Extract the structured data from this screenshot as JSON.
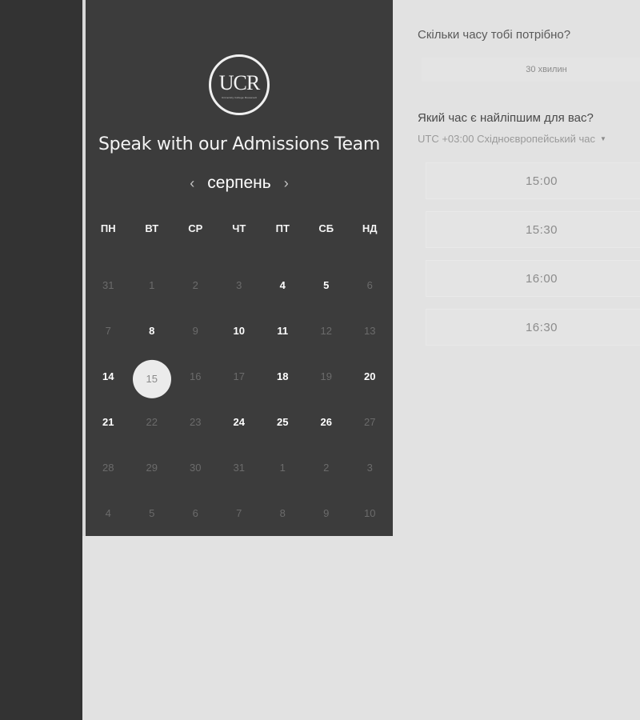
{
  "calendar": {
    "logo": {
      "text": "UCR",
      "subtitle": "University College Roosevelt"
    },
    "title": "Speak with our Admissions Team",
    "month": "серпень",
    "prev_icon": "chevron-left-icon",
    "next_icon": "chevron-right-icon",
    "weekdays": [
      "ПН",
      "ВТ",
      "СР",
      "ЧТ",
      "ПТ",
      "СБ",
      "НД"
    ],
    "days": [
      {
        "label": "31",
        "state": "disabled"
      },
      {
        "label": "1",
        "state": "disabled"
      },
      {
        "label": "2",
        "state": "disabled"
      },
      {
        "label": "3",
        "state": "disabled"
      },
      {
        "label": "4",
        "state": "available"
      },
      {
        "label": "5",
        "state": "available"
      },
      {
        "label": "6",
        "state": "disabled"
      },
      {
        "label": "7",
        "state": "disabled"
      },
      {
        "label": "8",
        "state": "available"
      },
      {
        "label": "9",
        "state": "disabled"
      },
      {
        "label": "10",
        "state": "available"
      },
      {
        "label": "11",
        "state": "available"
      },
      {
        "label": "12",
        "state": "disabled"
      },
      {
        "label": "13",
        "state": "disabled"
      },
      {
        "label": "14",
        "state": "available"
      },
      {
        "label": "15",
        "state": "selected"
      },
      {
        "label": "16",
        "state": "disabled"
      },
      {
        "label": "17",
        "state": "disabled"
      },
      {
        "label": "18",
        "state": "available"
      },
      {
        "label": "19",
        "state": "disabled"
      },
      {
        "label": "20",
        "state": "available"
      },
      {
        "label": "21",
        "state": "available"
      },
      {
        "label": "22",
        "state": "disabled"
      },
      {
        "label": "23",
        "state": "disabled"
      },
      {
        "label": "24",
        "state": "available"
      },
      {
        "label": "25",
        "state": "available"
      },
      {
        "label": "26",
        "state": "available"
      },
      {
        "label": "27",
        "state": "disabled"
      },
      {
        "label": "28",
        "state": "disabled"
      },
      {
        "label": "29",
        "state": "disabled"
      },
      {
        "label": "30",
        "state": "disabled"
      },
      {
        "label": "31",
        "state": "disabled"
      },
      {
        "label": "1",
        "state": "disabled"
      },
      {
        "label": "2",
        "state": "disabled"
      },
      {
        "label": "3",
        "state": "disabled"
      },
      {
        "label": "4",
        "state": "disabled"
      },
      {
        "label": "5",
        "state": "disabled"
      },
      {
        "label": "6",
        "state": "disabled"
      },
      {
        "label": "7",
        "state": "disabled"
      },
      {
        "label": "8",
        "state": "disabled"
      },
      {
        "label": "9",
        "state": "disabled"
      },
      {
        "label": "10",
        "state": "disabled"
      }
    ]
  },
  "scheduler": {
    "duration_question": "Скільки часу тобі потрібно?",
    "duration_value": "30 хвилин",
    "time_question": "Який час є найліпшим для вас?",
    "timezone": "UTC +03:00 Східноєвропейський час",
    "timezone_icon": "caret-down-icon",
    "slots": [
      "15:00",
      "15:30",
      "16:00",
      "16:30"
    ]
  },
  "colors": {
    "sidebar": "#333333",
    "calendar_bg": "#3c3c3c",
    "page_bg": "#e2e2e2",
    "selected_day": "#ebebeb"
  }
}
